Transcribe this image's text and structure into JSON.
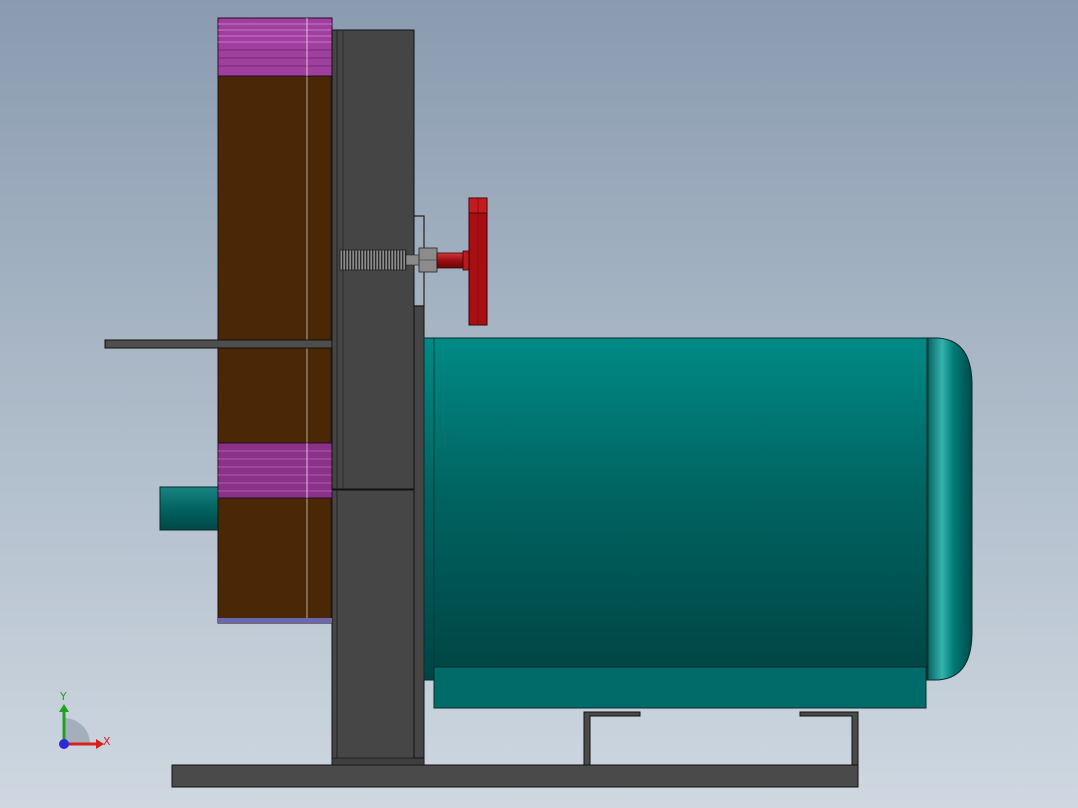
{
  "triad": {
    "x_label": "X",
    "y_label": "Y",
    "x_color": "#d92020",
    "y_color": "#22a022",
    "z_color": "#2a2ad6"
  },
  "colors": {
    "background_top": "#8a9bb0",
    "background_bottom": "#cfd8e1",
    "wood": "#4a2705",
    "pink_band": "#a0409e",
    "steel": "#454545",
    "motor": "#006f6c",
    "handwheel": "#a80f12",
    "shaft": "#005f5e"
  },
  "components": [
    "base-plate",
    "vertical-stand",
    "mounting-plate",
    "wood-disc",
    "pink-band-top",
    "pink-band-bottom",
    "tool-rest",
    "motor-shaft",
    "lead-screw",
    "handwheel",
    "motor-body",
    "motor-end-cap",
    "motor-foot",
    "motor-bracket-left",
    "motor-bracket-right"
  ]
}
